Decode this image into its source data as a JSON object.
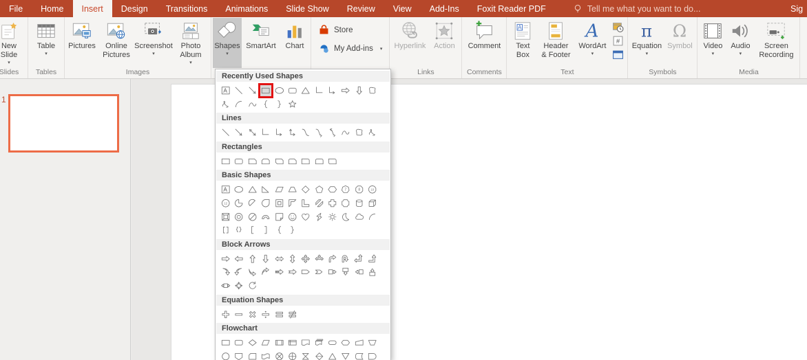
{
  "titlebar": {
    "tabs": [
      {
        "label": "File",
        "active": false
      },
      {
        "label": "Home",
        "active": false
      },
      {
        "label": "Insert",
        "active": true
      },
      {
        "label": "Design",
        "active": false
      },
      {
        "label": "Transitions",
        "active": false
      },
      {
        "label": "Animations",
        "active": false
      },
      {
        "label": "Slide Show",
        "active": false
      },
      {
        "label": "Review",
        "active": false
      },
      {
        "label": "View",
        "active": false
      },
      {
        "label": "Add-Ins",
        "active": false
      },
      {
        "label": "Foxit Reader PDF",
        "active": false
      }
    ],
    "tell_me": {
      "icon": "lightbulb-icon",
      "text": "Tell me what you want to do..."
    },
    "sign_in_partial": "Sig"
  },
  "ribbon": {
    "groups": [
      {
        "name": "slides",
        "label": "Slides",
        "buttons": [
          {
            "name": "new-slide",
            "label": "New\nSlide",
            "caret": true
          }
        ]
      },
      {
        "name": "tables",
        "label": "Tables",
        "buttons": [
          {
            "name": "table",
            "label": "Table",
            "caret": true
          }
        ]
      },
      {
        "name": "images",
        "label": "Images",
        "buttons": [
          {
            "name": "pictures",
            "label": "Pictures"
          },
          {
            "name": "online-pictures",
            "label": "Online\nPictures"
          },
          {
            "name": "screenshot",
            "label": "Screenshot",
            "caret": true
          },
          {
            "name": "photo-album",
            "label": "Photo\nAlbum",
            "caret": true
          }
        ]
      },
      {
        "name": "illustrations",
        "label": "",
        "buttons": [
          {
            "name": "shapes",
            "label": "Shapes",
            "caret": true,
            "pressed": true
          },
          {
            "name": "smartart",
            "label": "SmartArt"
          },
          {
            "name": "chart",
            "label": "Chart"
          }
        ]
      },
      {
        "name": "add-ins",
        "label": "",
        "stacked": true,
        "buttons": [
          {
            "name": "store",
            "label": "Store"
          },
          {
            "name": "my-add-ins",
            "label": "My Add-ins",
            "caret": true
          }
        ]
      },
      {
        "name": "links",
        "label": "Links",
        "buttons": [
          {
            "name": "hyperlink",
            "label": "Hyperlink",
            "disabled": true
          },
          {
            "name": "action",
            "label": "Action",
            "disabled": true
          }
        ]
      },
      {
        "name": "comments",
        "label": "Comments",
        "buttons": [
          {
            "name": "comment",
            "label": "Comment"
          }
        ]
      },
      {
        "name": "text",
        "label": "Text",
        "buttons": [
          {
            "name": "text-box-btn",
            "label": "Text\nBox"
          },
          {
            "name": "header-footer",
            "label": "Header\n& Footer"
          },
          {
            "name": "wordart",
            "label": "WordArt",
            "caret": true
          },
          {
            "name": "text-mini-stack",
            "mini_stack": [
              "date-time",
              "slide-number",
              "object"
            ]
          }
        ]
      },
      {
        "name": "symbols",
        "label": "Symbols",
        "buttons": [
          {
            "name": "equation",
            "label": "Equation",
            "caret": true
          },
          {
            "name": "symbol",
            "label": "Symbol",
            "disabled": true
          }
        ]
      },
      {
        "name": "media",
        "label": "Media",
        "buttons": [
          {
            "name": "video",
            "label": "Video",
            "caret": true
          },
          {
            "name": "audio",
            "label": "Audio",
            "caret": true
          },
          {
            "name": "screen-recording",
            "label": "Screen\nRecording"
          }
        ]
      }
    ]
  },
  "slides_panel": {
    "slide_number": "1"
  },
  "shapes_menu": {
    "highlight": {
      "section_index": 0,
      "shape_index": 3
    },
    "sections": [
      {
        "title": "Recently Used Shapes",
        "shapes": [
          "text-box",
          "line",
          "arrow",
          "rectangle",
          "oval",
          "rounded-rectangle",
          "isosceles-triangle",
          "elbow-connector",
          "elbow-arrow-connector",
          "arrow-right",
          "arrow-down",
          "freeform-shape",
          "scribble",
          "arc",
          "curve",
          "left-brace",
          "right-brace",
          "star-5-point"
        ]
      },
      {
        "title": "Lines",
        "shapes": [
          "line",
          "arrow",
          "double-arrow",
          "elbow-connector",
          "elbow-arrow-connector",
          "elbow-double-arrow-connector",
          "curved-connector",
          "curved-arrow-connector",
          "curved-double-arrow-connector",
          "curve",
          "freeform-shape",
          "scribble"
        ]
      },
      {
        "title": "Rectangles",
        "shapes": [
          "rectangle",
          "rounded-rectangle",
          "snip-single-corner-rectangle",
          "snip-same-side-corner-rectangle",
          "snip-diagonal-corner-rectangle",
          "snip-and-round-single-corner-rectangle",
          "round-single-corner-rectangle",
          "round-same-side-corner-rectangle",
          "round-diagonal-corner-rectangle"
        ]
      },
      {
        "title": "Basic Shapes",
        "shapes": [
          "text-box",
          "oval",
          "isosceles-triangle",
          "right-triangle",
          "parallelogram",
          "trapezoid",
          "diamond",
          "regular-pentagon",
          "hexagon",
          "heptagon",
          "octagon",
          "decagon",
          "dodecagon",
          "pie",
          "chord",
          "teardrop",
          "frame",
          "half-frame",
          "l-shape",
          "diagonal-stripe",
          "cross",
          "plaque",
          "can",
          "cube",
          "bevel",
          "donut",
          "no-symbol",
          "block-arc",
          "folded-corner",
          "smiley-face",
          "heart",
          "lightning-bolt",
          "sun",
          "moon",
          "cloud",
          "arc",
          "double-bracket",
          "double-brace",
          "left-bracket",
          "right-bracket",
          "left-brace",
          "right-brace"
        ]
      },
      {
        "title": "Block Arrows",
        "shapes": [
          "arrow-right",
          "arrow-left",
          "arrow-up",
          "arrow-down",
          "arrow-left-right",
          "arrow-up-down",
          "arrow-quad",
          "arrow-left-right-up",
          "arrow-bent",
          "arrow-u-turn",
          "arrow-left-up",
          "arrow-bent-up",
          "arrow-curved-right",
          "arrow-curved-left",
          "arrow-curved-down",
          "arrow-curved-up",
          "arrow-striped-right",
          "arrow-notched-right",
          "arrow-pentagon",
          "arrow-chevron",
          "callout-right-arrow",
          "callout-down-arrow",
          "callout-left-arrow",
          "callout-up-arrow",
          "callout-left-right-arrow",
          "callout-quad-arrow",
          "circular-arrow"
        ]
      },
      {
        "title": "Equation Shapes",
        "shapes": [
          "math-plus",
          "math-minus",
          "math-multiply",
          "math-division",
          "math-equal",
          "math-not-equal"
        ]
      },
      {
        "title": "Flowchart",
        "shapes": [
          "process",
          "alternate-process",
          "decision",
          "data",
          "predefined-process",
          "internal-storage",
          "document",
          "multidocument",
          "terminator",
          "preparation",
          "manual-input",
          "manual-operation",
          "connector",
          "off-page-connector",
          "card",
          "punched-tape",
          "summing-junction",
          "or",
          "collate",
          "sort",
          "extract",
          "merge",
          "stored-data",
          "delay"
        ]
      }
    ]
  },
  "colors": {
    "titlebar": "#B7472A",
    "active_tab_text": "#C8482B",
    "highlight_box": "#E21414",
    "thumbnail_border": "#ED6C47",
    "store_icon": "#D83B01",
    "ribbon_bg": "#F5F4F2"
  }
}
